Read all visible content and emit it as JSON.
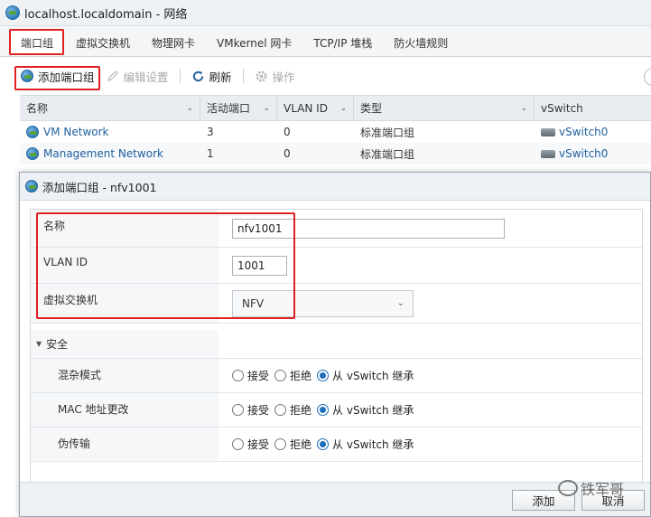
{
  "window": {
    "title": "localhost.localdomain - 网络"
  },
  "tabs": [
    {
      "label": "端口组",
      "active": true
    },
    {
      "label": "虚拟交换机"
    },
    {
      "label": "物理网卡"
    },
    {
      "label": "VMkernel 网卡"
    },
    {
      "label": "TCP/IP 堆栈"
    },
    {
      "label": "防火墙规则"
    }
  ],
  "toolbar": {
    "add_port_group": "添加端口组",
    "edit_settings": "编辑设置",
    "refresh": "刷新",
    "actions": "操作"
  },
  "grid": {
    "columns": [
      "名称",
      "活动端口",
      "VLAN ID",
      "类型",
      "vSwitch"
    ],
    "rows": [
      {
        "name": "VM Network",
        "active_ports": "3",
        "vlan": "0",
        "type": "标准端口组",
        "vswitch": "vSwitch0"
      },
      {
        "name": "Management Network",
        "active_ports": "1",
        "vlan": "0",
        "type": "标准端口组",
        "vswitch": "vSwitch0"
      }
    ]
  },
  "dialog": {
    "title": "添加端口组 - nfv1001",
    "name_label": "名称",
    "name_value": "nfv1001",
    "vlan_label": "VLAN ID",
    "vlan_value": "1001",
    "vswitch_label": "虚拟交换机",
    "vswitch_value": "NFV",
    "security_label": "安全",
    "security_rows": [
      {
        "label": "混杂模式",
        "options": [
          "接受",
          "拒绝",
          "从 vSwitch 继承"
        ],
        "selected": 2
      },
      {
        "label": "MAC 地址更改",
        "options": [
          "接受",
          "拒绝",
          "从 vSwitch 继承"
        ],
        "selected": 2
      },
      {
        "label": "伪传输",
        "options": [
          "接受",
          "拒绝",
          "从 vSwitch 继承"
        ],
        "selected": 2
      }
    ],
    "add_button": "添加",
    "cancel_button": "取消"
  },
  "watermark": "铁军哥",
  "colors": {
    "highlight_box": "#e02020",
    "accent": "#1f6fb8"
  }
}
